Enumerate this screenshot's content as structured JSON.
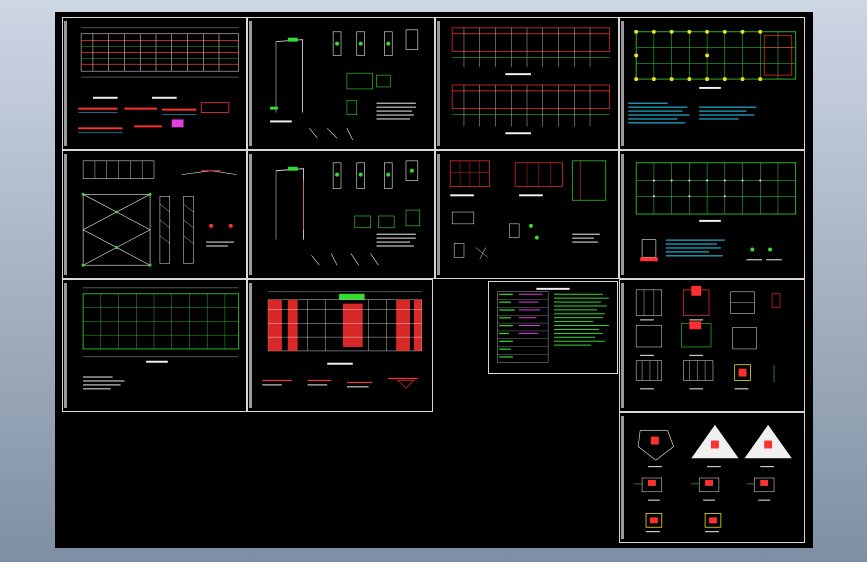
{
  "app": {
    "kind": "CAD drawing-set viewer"
  },
  "colors": {
    "background_gradient": [
      "#cdd6e3",
      "#7f8fa3"
    ],
    "model_space": "#000000",
    "sheet_border": "#d8d8d8",
    "grid_green": "#33dd33",
    "member_red": "#ff3030",
    "note_cyan": "#28d8ff",
    "text_white": "#f0f0f0",
    "dims": "#d0d0d0",
    "yellow": "#f0e020",
    "magenta": "#e040e0"
  },
  "sheets": [
    {
      "id": "s1",
      "name": "sheet-roof-plan-details",
      "title": ""
    },
    {
      "id": "s2",
      "name": "sheet-frame-section-details",
      "title": ""
    },
    {
      "id": "s3",
      "name": "sheet-frame-elevations",
      "title": ""
    },
    {
      "id": "s4",
      "name": "sheet-column-layout-plan",
      "title": ""
    },
    {
      "id": "s5",
      "name": "sheet-bracing-plan",
      "title": ""
    },
    {
      "id": "s6",
      "name": "sheet-gable-frame-details",
      "title": ""
    },
    {
      "id": "s7",
      "name": "sheet-wall-elevations",
      "title": ""
    },
    {
      "id": "s8",
      "name": "sheet-anchor-bolt-plan",
      "title": ""
    },
    {
      "id": "s9",
      "name": "sheet-purlin-plan",
      "title": ""
    },
    {
      "id": "s10",
      "name": "sheet-foundation-plan",
      "title": ""
    },
    {
      "id": "s11",
      "name": "sheet-design-notes",
      "title": ""
    },
    {
      "id": "s12",
      "name": "sheet-footing-details",
      "title": ""
    },
    {
      "id": "s13",
      "name": "sheet-pile-cap-details",
      "title": ""
    }
  ]
}
